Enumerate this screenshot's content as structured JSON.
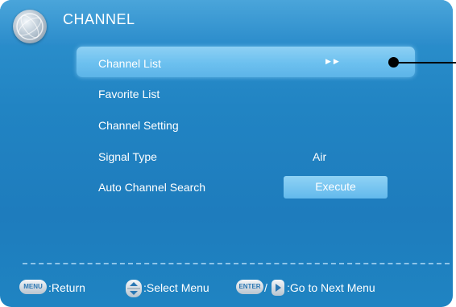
{
  "menu": {
    "title": "CHANNEL",
    "items": [
      {
        "label": "Channel List",
        "value": "",
        "selected": true
      },
      {
        "label": "Favorite List",
        "value": ""
      },
      {
        "label": "Channel Setting",
        "value": ""
      },
      {
        "label": "Signal Type",
        "value": "Air"
      },
      {
        "label": "Auto Channel Search",
        "value": "Execute"
      }
    ],
    "submenu_arrows": "▶▶"
  },
  "footer": {
    "menu_key": "MENU",
    "return_label": ":Return",
    "select_label": ":Select Menu",
    "enter_key": "ENTER",
    "slash": "/",
    "next_label": ":Go to Next Menu"
  },
  "colors": {
    "panel": "#2184c3",
    "highlight": "#6cc0ef",
    "text": "#ffffff"
  }
}
